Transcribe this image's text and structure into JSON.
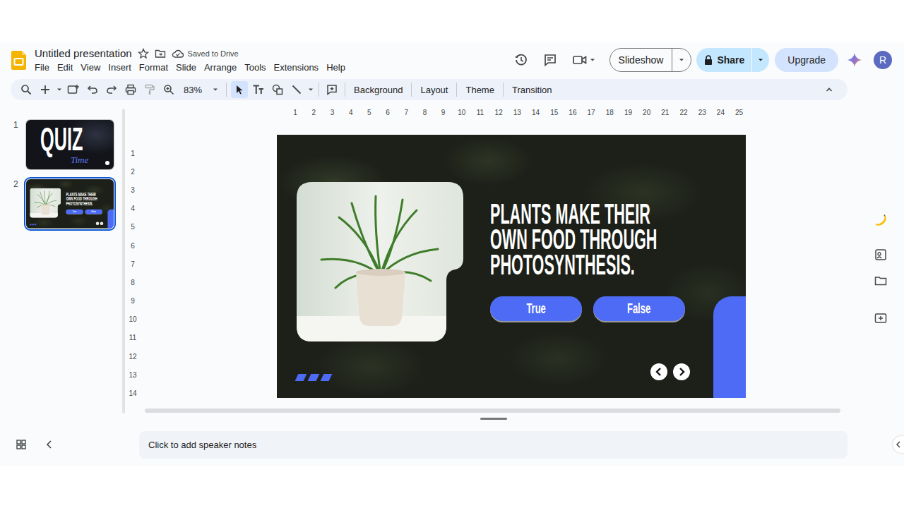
{
  "document": {
    "title": "Untitled presentation",
    "starred": false,
    "save_status": "Saved to Drive"
  },
  "menu": [
    "File",
    "Edit",
    "View",
    "Insert",
    "Format",
    "Slide",
    "Arrange",
    "Tools",
    "Extensions",
    "Help"
  ],
  "header_buttons": {
    "slideshow": "Slideshow",
    "share": "Share",
    "upgrade": "Upgrade",
    "avatar": "R"
  },
  "toolbar": {
    "zoom": "83%",
    "tools": [
      {
        "kind": "select",
        "selected": true
      },
      {
        "kind": "textbox",
        "selected": false
      },
      {
        "kind": "shape",
        "selected": false
      },
      {
        "kind": "line",
        "selected": false
      }
    ],
    "actions": [
      "Background",
      "Layout",
      "Theme",
      "Transition"
    ]
  },
  "filmstrip": [
    {
      "number": "1",
      "kind": "title",
      "selected": false,
      "title": "QUIZ",
      "subtitle": "Time"
    },
    {
      "number": "2",
      "kind": "question",
      "selected": true
    }
  ],
  "ruler": {
    "horizontal": [
      "1",
      "2",
      "3",
      "4",
      "5",
      "6",
      "7",
      "8",
      "9",
      "10",
      "11",
      "12",
      "13",
      "14",
      "15",
      "16",
      "17",
      "18",
      "19",
      "20",
      "21",
      "22",
      "23",
      "24",
      "25"
    ],
    "vertical": [
      "1",
      "2",
      "3",
      "4",
      "5",
      "6",
      "7",
      "8",
      "9",
      "10",
      "11",
      "12",
      "13",
      "14"
    ]
  },
  "slide": {
    "statement_lines": [
      "PLANTS MAKE THEIR",
      "OWN FOOD THROUGH",
      "PHOTOSYNTHESIS."
    ],
    "answers": [
      {
        "label": "True"
      },
      {
        "label": "False"
      }
    ]
  },
  "notes": {
    "placeholder": "Click to add speaker notes"
  }
}
